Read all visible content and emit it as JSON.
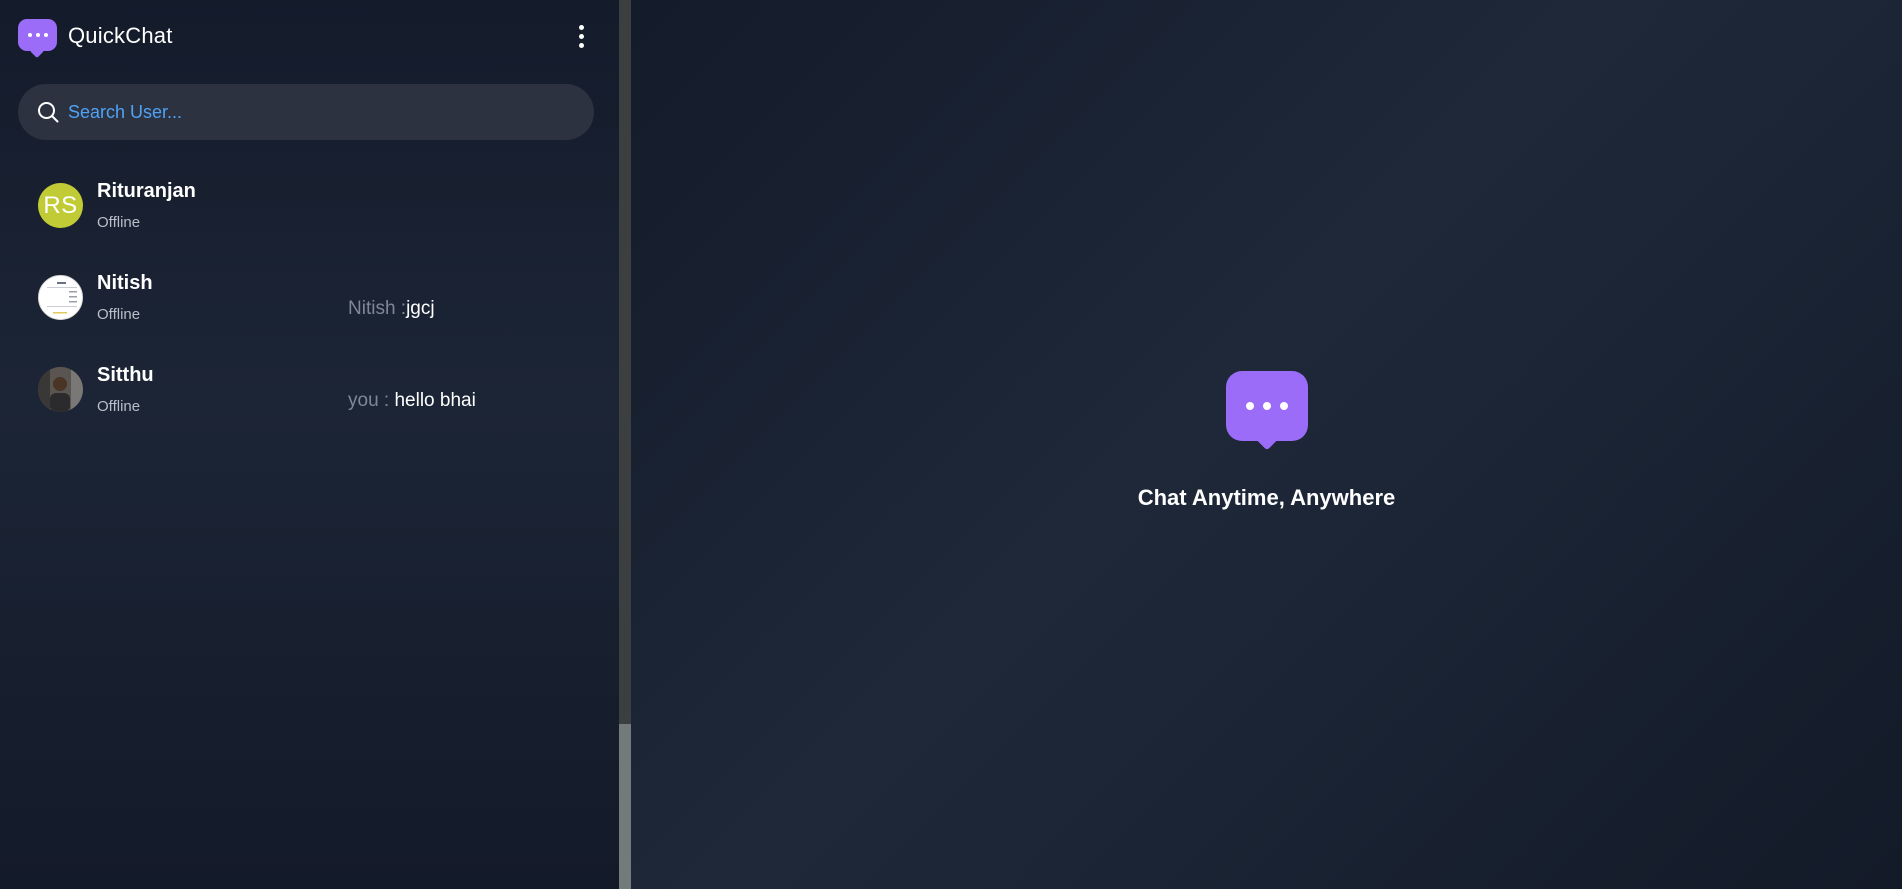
{
  "app": {
    "name": "QuickChat",
    "logo_icon": "chat-bubble-icon",
    "accent_color": "#9b6cf8"
  },
  "header": {
    "menu_icon": "kebab-menu-icon"
  },
  "search": {
    "placeholder": "Search User...",
    "value": "",
    "icon": "search-icon"
  },
  "users": [
    {
      "name": "Rituranjan",
      "status": "Offline",
      "avatar_type": "initials",
      "avatar_initials": "RS",
      "avatar_color": "#c0cb35",
      "last_message_sender": "",
      "last_message_text": ""
    },
    {
      "name": "Nitish",
      "status": "Offline",
      "avatar_type": "image",
      "last_message_sender": "Nitish :",
      "last_message_text": "jgcj"
    },
    {
      "name": "Sitthu",
      "status": "Offline",
      "avatar_type": "image",
      "last_message_sender": "you :",
      "last_message_text": "hello bhai"
    }
  ],
  "main": {
    "icon": "chat-bubble-icon",
    "tagline": "Chat Anytime, Anywhere"
  }
}
